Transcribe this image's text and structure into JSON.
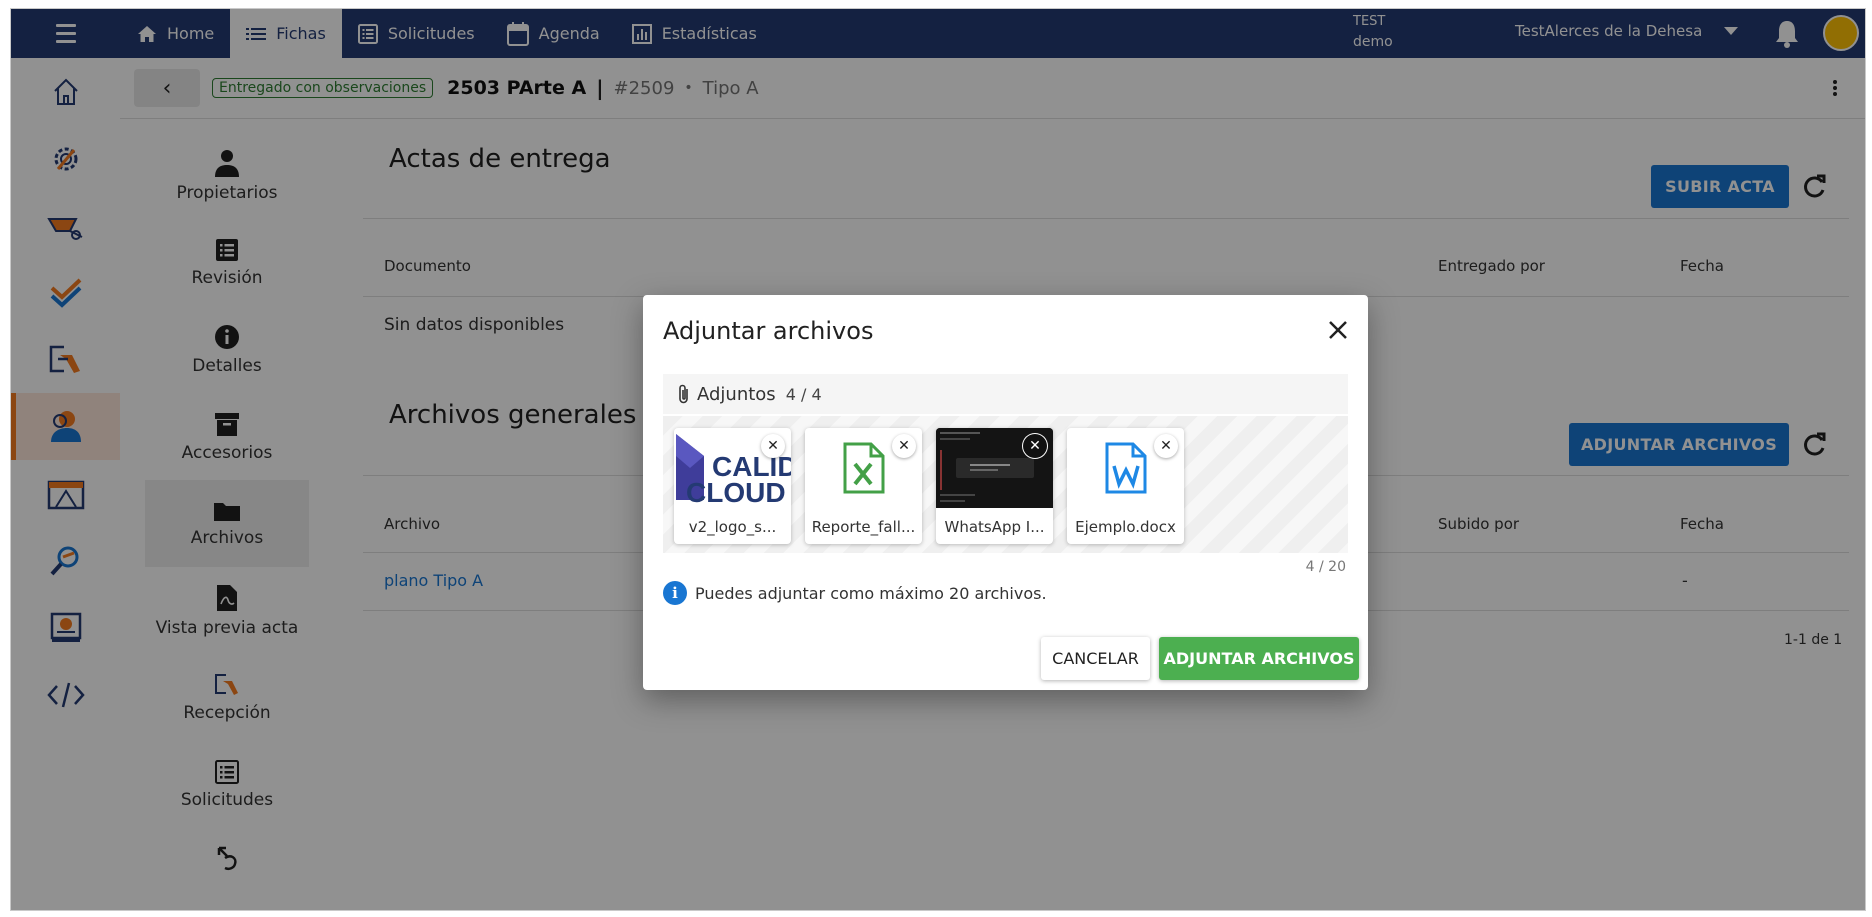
{
  "topbar": {
    "nav": [
      {
        "label": "Home",
        "icon": "home-icon"
      },
      {
        "label": "Fichas",
        "icon": "list-icon",
        "active": true
      },
      {
        "label": "Solicitudes",
        "icon": "list-box-icon"
      },
      {
        "label": "Agenda",
        "icon": "calendar-icon"
      },
      {
        "label": "Estadísticas",
        "icon": "bar-chart-icon"
      }
    ],
    "env_line1": "TEST",
    "env_line2": "demo",
    "project": "TestAlerces de la Dehesa"
  },
  "ficha": {
    "status": "Entregado con observaciones",
    "title": "2503 PArte A",
    "separator": "|",
    "id": "#2509",
    "dot": "•",
    "type": "Tipo A"
  },
  "subnav": [
    {
      "label": "Propietarios",
      "icon": "person-icon"
    },
    {
      "label": "Revisión",
      "icon": "list-box-icon"
    },
    {
      "label": "Detalles",
      "icon": "info-icon"
    },
    {
      "label": "Accesorios",
      "icon": "archive-box-icon"
    },
    {
      "label": "Archivos",
      "icon": "folder-icon",
      "active": true
    },
    {
      "label": "Vista previa acta",
      "icon": "pdf-file-icon"
    },
    {
      "label": "Recepción",
      "icon": "reception-icon"
    },
    {
      "label": "Solicitudes",
      "icon": "list-box-icon"
    }
  ],
  "actas": {
    "title": "Actas de entrega",
    "upload_label": "SUBIR ACTA",
    "col_documento": "Documento",
    "col_entregado_por": "Entregado por",
    "col_fecha": "Fecha",
    "empty": "Sin datos disponibles"
  },
  "archivos": {
    "title": "Archivos generales",
    "attach_label": "ADJUNTAR ARCHIVOS",
    "col_archivo": "Archivo",
    "col_subido_por": "Subido por",
    "col_fecha": "Fecha",
    "rows": [
      {
        "archivo": "plano Tipo A",
        "fecha": "-"
      }
    ],
    "pagination": "1-1 de 1"
  },
  "dialog": {
    "title": "Adjuntar archivos",
    "attachments_label": "Adjuntos",
    "attachments_count": "4 / 4",
    "files": [
      {
        "name": "v2_logo_s...",
        "kind": "image-logo",
        "logo_text_1": "CALID",
        "logo_text_2": "CLOUD"
      },
      {
        "name": "Reporte_fall...",
        "kind": "excel"
      },
      {
        "name": "WhatsApp I...",
        "kind": "image-screenshot"
      },
      {
        "name": "Ejemplo.docx",
        "kind": "word"
      }
    ],
    "limit_counter": "4 / 20",
    "info": "Puedes adjuntar como máximo 20 archivos.",
    "cancel_label": "CANCELAR",
    "confirm_label": "ADJUNTAR ARCHIVOS"
  },
  "colors": {
    "topbar": "#243a73",
    "primary": "#1976d2",
    "success": "#4caf50",
    "accent": "#f47b20",
    "avatar": "#ffc107"
  }
}
